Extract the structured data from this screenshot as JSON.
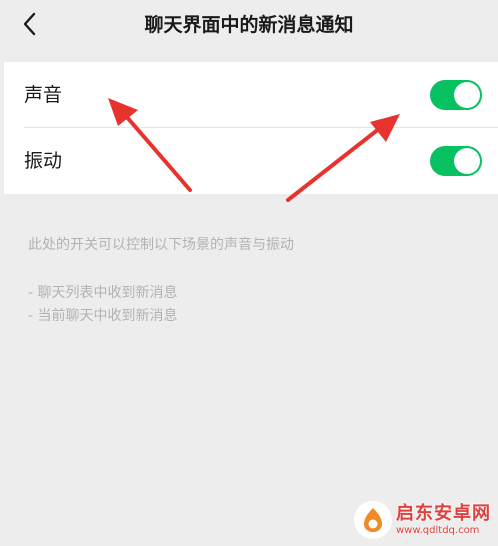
{
  "nav": {
    "title": "聊天界面中的新消息通知"
  },
  "settings": {
    "items": [
      {
        "label": "声音",
        "enabled": true
      },
      {
        "label": "振动",
        "enabled": true
      }
    ]
  },
  "hint": {
    "description": "此处的开关可以控制以下场景的声音与振动",
    "items": [
      "- 聊天列表中收到新消息",
      "- 当前聊天中收到新消息"
    ]
  },
  "watermark": {
    "name": "启东安卓网",
    "url": "www.qdltdq.com"
  },
  "colors": {
    "background": "#ededed",
    "card": "#ffffff",
    "toggle_on": "#07c160",
    "hint_text": "#b2b2b2",
    "annotation_arrow": "#e8322e"
  },
  "icons": {
    "back": "chevron-left-icon",
    "annotation": "red-arrow-icon"
  }
}
